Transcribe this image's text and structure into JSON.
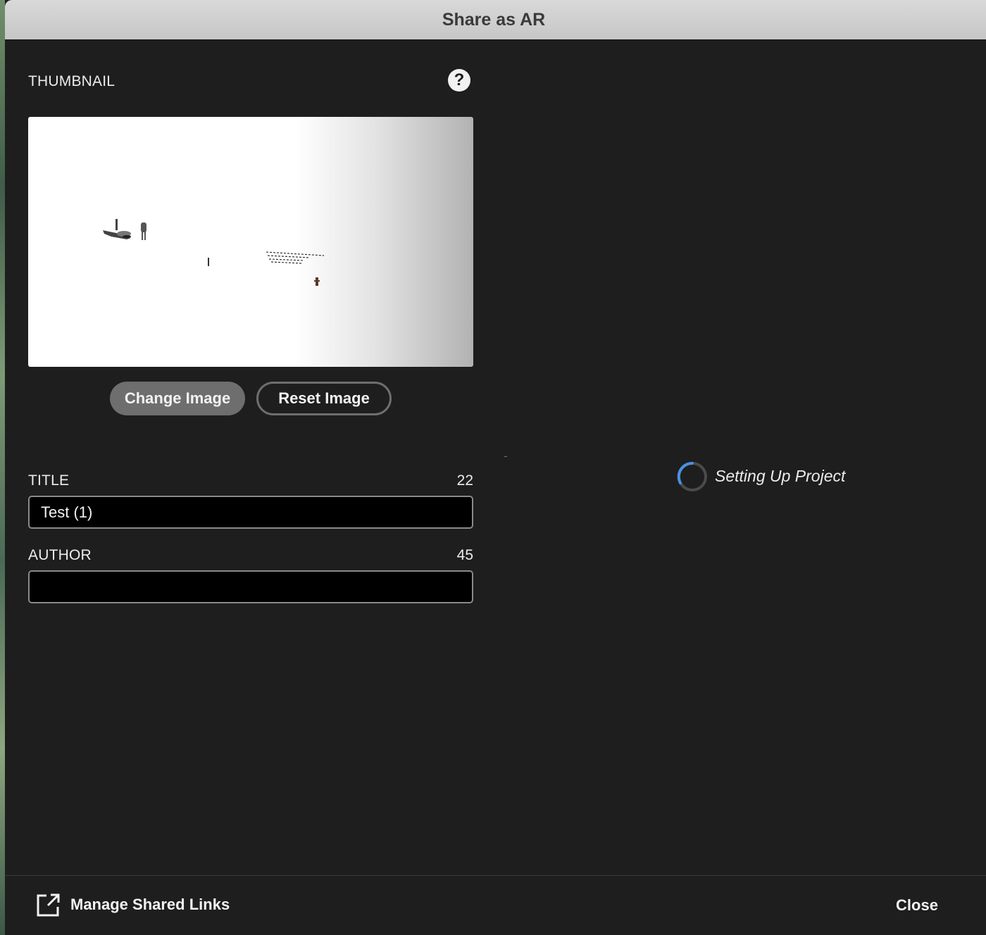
{
  "window": {
    "title": "Share as AR"
  },
  "thumbnail": {
    "label": "THUMBNAIL",
    "help_icon": "help-icon",
    "change_button": "Change Image",
    "reset_button": "Reset Image"
  },
  "title_field": {
    "label": "TITLE",
    "remaining": "22",
    "value": "Test (1)"
  },
  "author_field": {
    "label": "AUTHOR",
    "remaining": "45",
    "value": ""
  },
  "status": {
    "text": "Setting Up Project",
    "icon": "spinner-icon",
    "accent": "#4a90e2"
  },
  "footer": {
    "manage_links": "Manage Shared Links",
    "manage_icon": "external-link-icon",
    "close": "Close"
  }
}
